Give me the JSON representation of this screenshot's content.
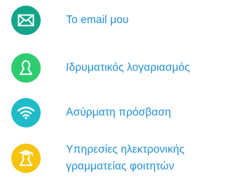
{
  "menu": {
    "items": [
      {
        "label": "Το email μου",
        "icon": "envelope-icon",
        "color": "#13a588"
      },
      {
        "label": "Ιδρυματικός λογαριασμός",
        "icon": "user-icon",
        "color": "#2ecc71"
      },
      {
        "label": "Ασύρματη πρόσβαση",
        "icon": "wifi-icon",
        "color": "#1fbbc9"
      },
      {
        "label_line1": "Υπηρεσίες ηλεκτρονικής",
        "label_line2": "γραμματείας φοιτητών",
        "icon": "graduate-icon",
        "color": "#f6c40f"
      }
    ]
  }
}
